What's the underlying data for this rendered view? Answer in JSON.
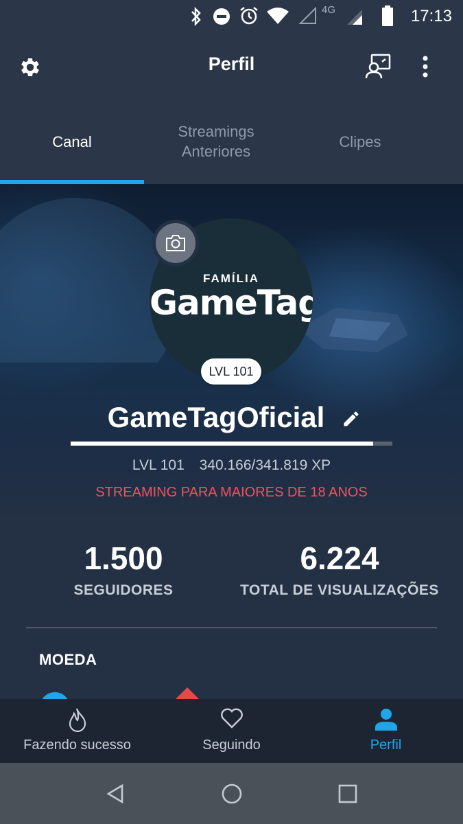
{
  "status_bar": {
    "time": "17:13",
    "network": "4G",
    "icons": [
      "bluetooth-icon",
      "do-not-disturb-icon",
      "alarm-icon",
      "wifi-icon",
      "signal-empty-icon",
      "signal-4g-icon",
      "battery-icon"
    ]
  },
  "app_bar": {
    "title": "Perfil",
    "icons": [
      "gear-icon",
      "cast-profile-icon",
      "more-vert-icon"
    ]
  },
  "tabs": [
    {
      "label": "Canal",
      "active": true
    },
    {
      "label": "Streamings Anteriores",
      "active": false
    },
    {
      "label": "Clipes",
      "active": false
    }
  ],
  "profile": {
    "avatar_logo_top": "FAMÍLIA",
    "avatar_logo_main": "GameTag",
    "level_badge": "LVL 101",
    "username": "GameTagOficial",
    "level": "LVL 101",
    "xp": "340.166/341.819 XP",
    "xp_progress": 0.9952,
    "warning": "STREAMING PARA MAIORES DE 18 ANOS"
  },
  "stats": [
    {
      "value": "1.500",
      "label": "SEGUIDORES"
    },
    {
      "value": "6.224",
      "label": "TOTAL DE VISUALIZAÇÕES"
    }
  ],
  "currency": {
    "title": "MOEDA"
  },
  "bottom_nav": [
    {
      "label": "Fazendo sucesso",
      "icon": "flame-icon",
      "active": false
    },
    {
      "label": "Seguindo",
      "icon": "heart-icon",
      "active": false
    },
    {
      "label": "Perfil",
      "icon": "person-icon",
      "active": true
    }
  ],
  "colors": {
    "accent": "#1fa6e8",
    "warning": "#f0525f",
    "background": "#243044",
    "bar": "#2b3648"
  }
}
